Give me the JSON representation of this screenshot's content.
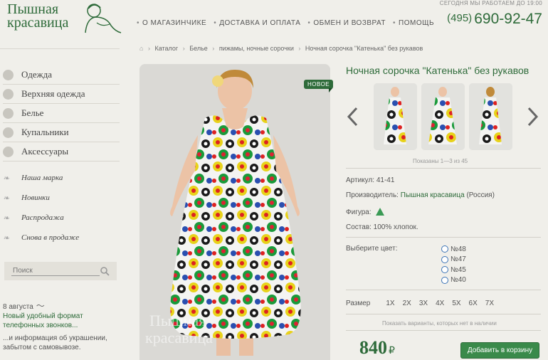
{
  "header": {
    "logo_line1": "Пышная",
    "logo_line2": "красавица",
    "nav": [
      "о магазинчике",
      "доставка и оплата",
      "обмен и возврат",
      "помощь"
    ],
    "hours": "Сегодня мы работаем до 19:00",
    "phone_code": "(495)",
    "phone_number": "690-92-47"
  },
  "breadcrumb": [
    "Каталог",
    "Белье",
    "пижамы, ночные сорочки",
    "Ночная сорочка \"Катенька\" без рукавов"
  ],
  "sidebar": {
    "main": [
      {
        "label": "Одежда",
        "icon": "dress-icon"
      },
      {
        "label": "Верхняя одежда",
        "icon": "coat-icon"
      },
      {
        "label": "Белье",
        "icon": "lingerie-icon"
      },
      {
        "label": "Купальники",
        "icon": "swimsuit-icon"
      },
      {
        "label": "Аксессуары",
        "icon": "accessory-icon"
      }
    ],
    "sub": [
      "Наша марка",
      "Новинки",
      "Распродажа",
      "Снова в продаже"
    ],
    "search_placeholder": "Поиск",
    "news": {
      "date": "8 августа",
      "link": "Новый удобный формат телефонных звонков...",
      "more": "...и информация об украшении, забытом с самовывозе."
    }
  },
  "product": {
    "badge": "НОВОЕ",
    "watermark_line1": "Пышная",
    "watermark_line2": "красавица",
    "title": "Ночная сорочка \"Катенька\" без рукавов",
    "thumbs_shown": "Показаны 1—3 из 45",
    "article_label": "Артикул:",
    "article": "41-41",
    "maker_label": "Производитель:",
    "maker": "Пышная красавица",
    "maker_country": "(Россия)",
    "figure_label": "Фигура:",
    "composition": "Состав: 100% хлопок.",
    "color_label": "Выберите цвет:",
    "colors": [
      "№48",
      "№47",
      "№45",
      "№40"
    ],
    "size_label": "Размер",
    "sizes": [
      "1X",
      "2X",
      "3X",
      "4X",
      "5X",
      "6X",
      "7X"
    ],
    "hidden_note": "Показать варианты, которых нет в наличии",
    "price": "840",
    "currency": "₽",
    "cart_button": "Добавить в корзину"
  }
}
